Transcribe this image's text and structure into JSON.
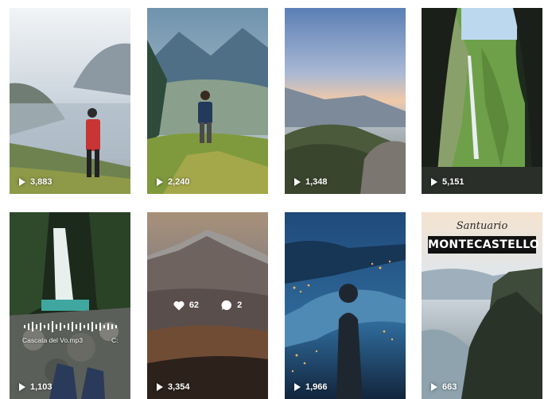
{
  "posts": [
    {
      "views": "3,883"
    },
    {
      "views": "2,240"
    },
    {
      "views": "1,348"
    },
    {
      "views": "5,151"
    },
    {
      "views": "1,103",
      "audio": {
        "name": "Cascata del Vo.mp3",
        "extra": "C:"
      }
    },
    {
      "views": "3,354",
      "likes": "62",
      "comments": "2"
    },
    {
      "views": "1,966"
    },
    {
      "views": "663",
      "overlay": {
        "kicker": "Santuario",
        "title": "MONTECASTELLO"
      }
    }
  ],
  "icons": {
    "play": "play-icon",
    "like": "heart-icon",
    "comment": "comment-icon",
    "audio": "waveform-icon"
  },
  "colors": {
    "background": "#ffffff",
    "overlay_text": "#ffffff"
  }
}
